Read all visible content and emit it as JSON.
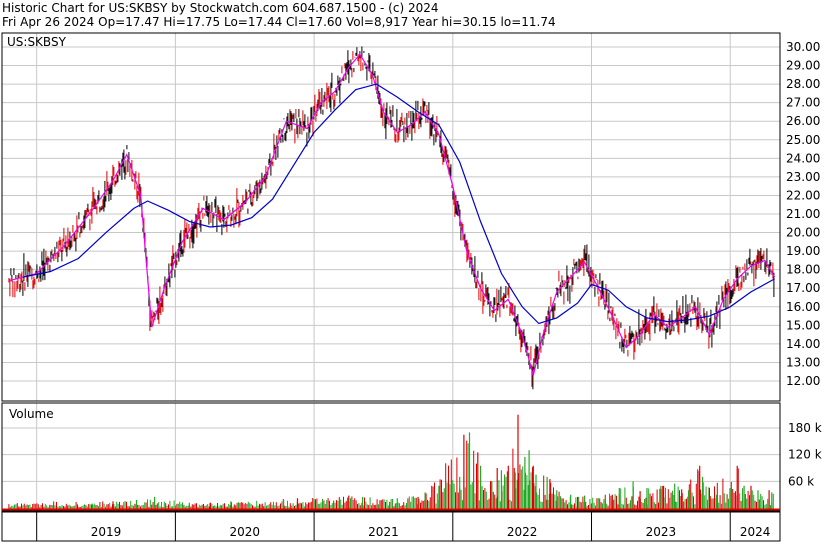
{
  "header": {
    "line1": "Historic Chart for US:SKBSY by Stockwatch.com 604.687.1500 - (c) 2024",
    "line2": "Fri Apr 26 2024   Op=17.47  Hi=17.75  Lo=17.44  Cl=17.60  Vol=8,917  Year hi=30.15  lo=11.74"
  },
  "price_panel": {
    "symbol": "US:SKBSY"
  },
  "volume_panel": {
    "title": "Volume"
  },
  "colors": {
    "up": "#000000",
    "down": "#dd0000",
    "ma_short": "#ee00ee",
    "ma_long": "#0000cc",
    "vol_up": "#22aa22",
    "vol_down": "#dd0000",
    "grid": "#c8c8c8"
  },
  "chart_data": [
    {
      "type": "line",
      "title": "US:SKBSY",
      "ylim": [
        11,
        30.6
      ],
      "y_ticks": [
        "12.00",
        "13.00",
        "14.00",
        "15.00",
        "16.00",
        "17.00",
        "18.00",
        "19.00",
        "20.00",
        "21.00",
        "22.00",
        "23.00",
        "24.00",
        "25.00",
        "26.00",
        "27.00",
        "28.00",
        "29.00",
        "30.00"
      ],
      "x_ticks": [
        "2019",
        "2020",
        "2021",
        "2022",
        "2023",
        "2024"
      ],
      "grid": true,
      "series": [
        {
          "values": [
            [
              2018.8,
              17.4
            ],
            [
              2019.0,
              17.8
            ],
            [
              2019.2,
              19.3
            ],
            [
              2019.4,
              21.2
            ],
            [
              2019.55,
              22.8
            ],
            [
              2019.65,
              24.2
            ],
            [
              2019.75,
              22.0
            ],
            [
              2019.83,
              14.9
            ],
            [
              2019.92,
              17.0
            ],
            [
              2020.05,
              19.5
            ],
            [
              2020.2,
              21.3
            ],
            [
              2020.35,
              20.7
            ],
            [
              2020.5,
              21.6
            ],
            [
              2020.65,
              23.0
            ],
            [
              2020.8,
              26.0
            ],
            [
              2020.95,
              25.6
            ],
            [
              2021.05,
              27.0
            ],
            [
              2021.15,
              27.6
            ],
            [
              2021.25,
              28.9
            ],
            [
              2021.33,
              29.6
            ],
            [
              2021.42,
              28.5
            ],
            [
              2021.5,
              26.5
            ],
            [
              2021.6,
              25.4
            ],
            [
              2021.7,
              25.8
            ],
            [
              2021.8,
              26.5
            ],
            [
              2021.9,
              25.3
            ],
            [
              2022.0,
              22.5
            ],
            [
              2022.1,
              19.0
            ],
            [
              2022.2,
              17.0
            ],
            [
              2022.3,
              15.8
            ],
            [
              2022.4,
              16.4
            ],
            [
              2022.5,
              14.5
            ],
            [
              2022.58,
              12.3
            ],
            [
              2022.65,
              14.5
            ],
            [
              2022.75,
              16.8
            ],
            [
              2022.85,
              17.6
            ],
            [
              2022.95,
              18.4
            ],
            [
              2023.05,
              17.0
            ],
            [
              2023.15,
              15.5
            ],
            [
              2023.25,
              13.8
            ],
            [
              2023.35,
              14.5
            ],
            [
              2023.45,
              15.6
            ],
            [
              2023.55,
              14.9
            ],
            [
              2023.65,
              15.4
            ],
            [
              2023.75,
              16.0
            ],
            [
              2023.85,
              14.5
            ],
            [
              2023.95,
              16.4
            ],
            [
              2024.05,
              17.5
            ],
            [
              2024.15,
              18.2
            ],
            [
              2024.25,
              18.5
            ],
            [
              2024.32,
              17.6
            ]
          ]
        },
        {
          "values": [
            [
              2018.9,
              17.6
            ],
            [
              2019.1,
              17.9
            ],
            [
              2019.3,
              18.6
            ],
            [
              2019.5,
              20.0
            ],
            [
              2019.7,
              21.3
            ],
            [
              2019.8,
              21.7
            ],
            [
              2019.95,
              21.2
            ],
            [
              2020.1,
              20.6
            ],
            [
              2020.25,
              20.3
            ],
            [
              2020.4,
              20.4
            ],
            [
              2020.55,
              20.8
            ],
            [
              2020.7,
              21.8
            ],
            [
              2020.85,
              23.6
            ],
            [
              2021.0,
              25.4
            ],
            [
              2021.15,
              26.6
            ],
            [
              2021.3,
              27.7
            ],
            [
              2021.45,
              28.0
            ],
            [
              2021.6,
              27.3
            ],
            [
              2021.75,
              26.5
            ],
            [
              2021.9,
              25.8
            ],
            [
              2022.05,
              23.8
            ],
            [
              2022.2,
              20.6
            ],
            [
              2022.35,
              17.8
            ],
            [
              2022.5,
              16.0
            ],
            [
              2022.62,
              15.1
            ],
            [
              2022.75,
              15.4
            ],
            [
              2022.9,
              16.2
            ],
            [
              2023.0,
              17.2
            ],
            [
              2023.12,
              16.9
            ],
            [
              2023.25,
              16.0
            ],
            [
              2023.4,
              15.4
            ],
            [
              2023.55,
              15.2
            ],
            [
              2023.7,
              15.3
            ],
            [
              2023.85,
              15.5
            ],
            [
              2024.0,
              16.0
            ],
            [
              2024.15,
              16.8
            ],
            [
              2024.32,
              17.5
            ]
          ]
        }
      ]
    },
    {
      "type": "bar",
      "title": "Volume",
      "y_ticks": [
        "60 k",
        "120 k",
        "180 k"
      ],
      "ylim": [
        0,
        210
      ],
      "series": [
        {
          "values": [
            [
              2019.4,
              10
            ],
            [
              2019.72,
              18
            ],
            [
              2019.85,
              25
            ],
            [
              2020.1,
              12
            ],
            [
              2020.4,
              15
            ],
            [
              2020.78,
              18
            ],
            [
              2021.0,
              20
            ],
            [
              2021.35,
              25
            ],
            [
              2021.6,
              22
            ],
            [
              2021.8,
              35
            ],
            [
              2021.9,
              50
            ],
            [
              2022.05,
              70
            ],
            [
              2022.12,
              170
            ],
            [
              2022.2,
              95
            ],
            [
              2022.28,
              60
            ],
            [
              2022.35,
              85
            ],
            [
              2022.45,
              80
            ],
            [
              2022.52,
              115
            ],
            [
              2022.55,
              130
            ],
            [
              2022.6,
              75
            ],
            [
              2022.68,
              70
            ],
            [
              2022.75,
              40
            ],
            [
              2022.85,
              30
            ],
            [
              2022.95,
              28
            ],
            [
              2023.1,
              30
            ],
            [
              2023.2,
              45
            ],
            [
              2023.3,
              60
            ],
            [
              2023.4,
              45
            ],
            [
              2023.5,
              50
            ],
            [
              2023.6,
              55
            ],
            [
              2023.7,
              40
            ],
            [
              2023.8,
              70
            ],
            [
              2023.9,
              30
            ],
            [
              2024.0,
              45
            ],
            [
              2024.1,
              50
            ],
            [
              2024.2,
              40
            ],
            [
              2024.3,
              35
            ]
          ]
        },
        {
          "values": [
            [
              2019.55,
              15
            ],
            [
              2020.25,
              12
            ],
            [
              2020.88,
              22
            ],
            [
              2021.25,
              28
            ],
            [
              2021.75,
              25
            ],
            [
              2022.08,
              165
            ],
            [
              2022.18,
              125
            ],
            [
              2022.32,
              90
            ],
            [
              2022.4,
              95
            ],
            [
              2022.47,
              210
            ],
            [
              2022.58,
              95
            ],
            [
              2022.7,
              65
            ],
            [
              2022.9,
              25
            ],
            [
              2023.15,
              30
            ],
            [
              2023.35,
              38
            ],
            [
              2023.52,
              50
            ],
            [
              2023.65,
              42
            ],
            [
              2023.78,
              95
            ],
            [
              2023.85,
              45
            ],
            [
              2024.05,
              95
            ],
            [
              2024.15,
              50
            ],
            [
              2024.28,
              40
            ]
          ]
        }
      ]
    }
  ]
}
